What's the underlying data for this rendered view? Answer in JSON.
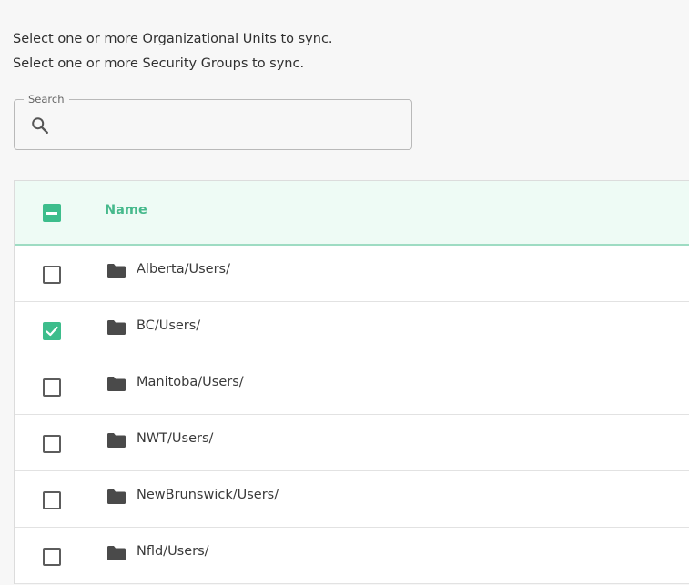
{
  "instructions": {
    "line1": "Select one or more Organizational Units to sync.",
    "line2": "Select one or more Security Groups to sync."
  },
  "search": {
    "label": "Search",
    "value": "",
    "icon": "search-icon"
  },
  "table": {
    "header": {
      "name_label": "Name",
      "select_all_state": "indeterminate"
    },
    "rows": [
      {
        "label": "Alberta/Users/",
        "checked": false,
        "icon": "folder-icon"
      },
      {
        "label": "BC/Users/",
        "checked": true,
        "icon": "folder-icon"
      },
      {
        "label": "Manitoba/Users/",
        "checked": false,
        "icon": "folder-icon"
      },
      {
        "label": "NWT/Users/",
        "checked": false,
        "icon": "folder-icon"
      },
      {
        "label": "NewBrunswick/Users/",
        "checked": false,
        "icon": "folder-icon"
      },
      {
        "label": "Nfld/Users/",
        "checked": false,
        "icon": "folder-icon"
      }
    ]
  },
  "colors": {
    "accent": "#3dbd8c",
    "header_bg": "#eefbf5",
    "header_text": "#46b98c"
  }
}
